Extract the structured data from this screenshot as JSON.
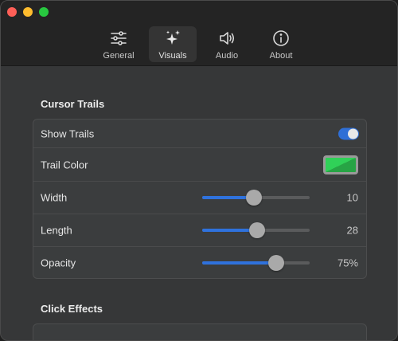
{
  "toolbar": {
    "tabs": [
      {
        "label": "General",
        "icon": "sliders-icon",
        "active": false
      },
      {
        "label": "Visuals",
        "icon": "sparkles-icon",
        "active": true
      },
      {
        "label": "Audio",
        "icon": "speaker-icon",
        "active": false
      },
      {
        "label": "About",
        "icon": "info-icon",
        "active": false
      }
    ]
  },
  "cursor_trails": {
    "title": "Cursor Trails",
    "show_trails": {
      "label": "Show Trails",
      "enabled": true
    },
    "trail_color": {
      "label": "Trail Color",
      "color": "#30d158"
    },
    "width": {
      "label": "Width",
      "value_text": "10",
      "fraction": 0.48
    },
    "length": {
      "label": "Length",
      "value_text": "28",
      "fraction": 0.51
    },
    "opacity": {
      "label": "Opacity",
      "value_text": "75%",
      "fraction": 0.69
    }
  },
  "click_effects": {
    "title": "Click Effects"
  },
  "colors": {
    "accent": "#2f72dd",
    "trail": "#30d158"
  }
}
